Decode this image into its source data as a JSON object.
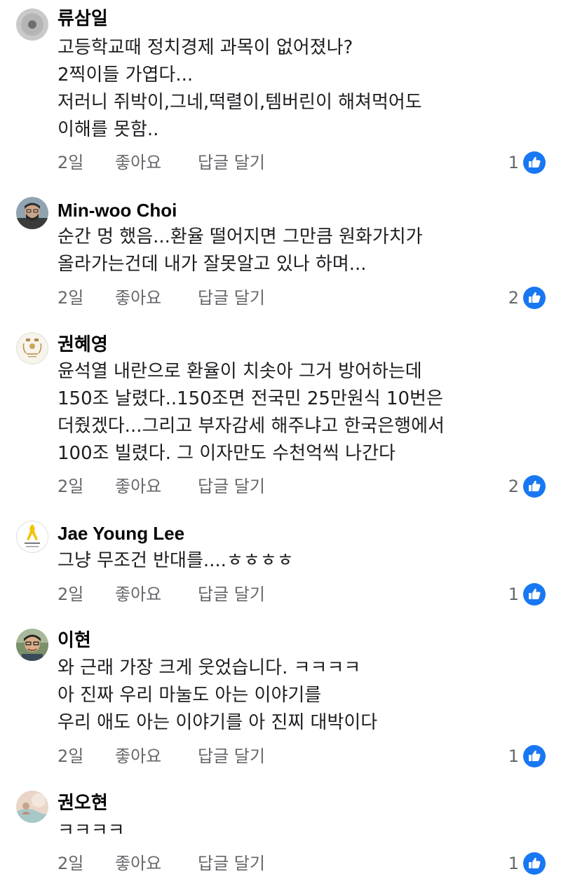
{
  "comments": [
    {
      "author": "류삼일",
      "lines": [
        "고등학교때 정치경제 과목이 없어졌나?",
        "2찍이들 가엽다...",
        "저러니 쥐박이,그네,떡렬이,템버린이 해쳐먹어도",
        "이해를 못함.."
      ],
      "time": "2일",
      "like_label": "좋아요",
      "reply_label": "답글 달기",
      "reaction_count": "1",
      "reaction_icon": "thumbs-up-icon"
    },
    {
      "author": "Min-woo Choi",
      "lines": [
        "순간 멍 했음...환율 떨어지면 그만큼 원화가치가",
        "올라가는건데 내가 잘못알고 있나 하며..."
      ],
      "time": "2일",
      "like_label": "좋아요",
      "reply_label": "답글 달기",
      "reaction_count": "2",
      "reaction_icon": "thumbs-up-icon"
    },
    {
      "author": "권혜영",
      "lines": [
        "윤석열 내란으로 환율이 치솟아 그거 방어하는데",
        "150조 날렸다..150조면 전국민 25만원식 10번은",
        "더줬겠다...그리고 부자감세 해주냐고 한국은행에서",
        "100조 빌렸다. 그 이자만도 수천억씩 나간다"
      ],
      "time": "2일",
      "like_label": "좋아요",
      "reply_label": "답글 달기",
      "reaction_count": "2",
      "reaction_icon": "thumbs-up-icon"
    },
    {
      "author": "Jae Young Lee",
      "lines": [
        "그냥 무조건 반대를....ㅎㅎㅎㅎ"
      ],
      "time": "2일",
      "like_label": "좋아요",
      "reply_label": "답글 달기",
      "reaction_count": "1",
      "reaction_icon": "thumbs-up-icon"
    },
    {
      "author": "이현",
      "lines": [
        "와  근래 가장 크게 웃었습니다. ㅋㅋㅋㅋ",
        "아  진짜 우리 마눌도 아는 이야기를",
        "우리 애도 아는 이야기를 아 진찌 대박이다"
      ],
      "time": "2일",
      "like_label": "좋아요",
      "reply_label": "답글 달기",
      "reaction_count": "1",
      "reaction_icon": "thumbs-up-icon"
    },
    {
      "author": "권오현",
      "lines": [
        "ㅋㅋㅋㅋ"
      ],
      "time": "2일",
      "like_label": "좋아요",
      "reply_label": "답글 달기",
      "reaction_count": "1",
      "reaction_icon": "thumbs-up-icon"
    }
  ],
  "colors": {
    "author": "#050505",
    "text": "#1c1e21",
    "meta": "#65676b",
    "like_blue": "#1877f2"
  }
}
